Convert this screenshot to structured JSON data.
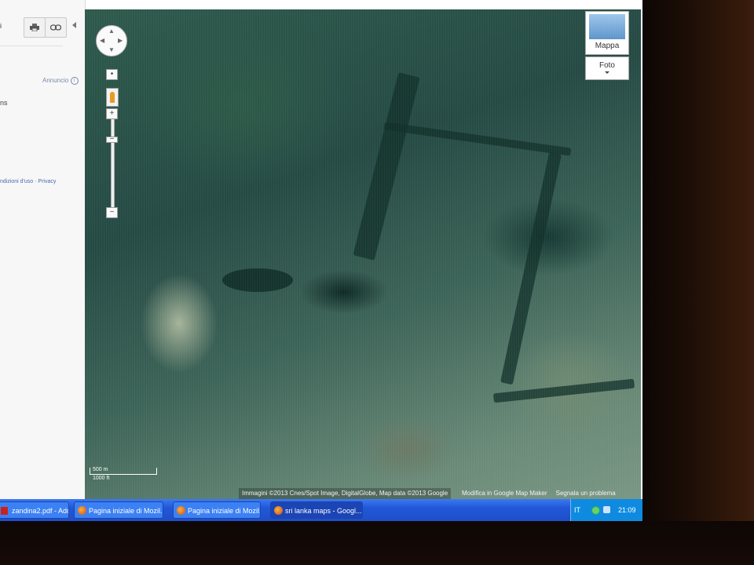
{
  "left_panel": {
    "cut_label_top": "i",
    "print_icon": "printer-icon",
    "link_icon": "link-icon",
    "collapse_icon": "chevron-left-icon",
    "ad_label": "Annuncio",
    "ad_info_icon": "info-icon",
    "cut_text": "ns",
    "footer_text": "ndizioni d'uso · Privacy"
  },
  "map": {
    "map_type_label": "Mappa",
    "photo_label": "Foto",
    "attribution": "Immagini ©2013 Cnes/Spot Image, DigitalGlobe, Map data ©2013 Google",
    "edit_link": "Modifica in Google Map Maker",
    "report_link": "Segnala un problema",
    "scale_top": "500 m",
    "scale_bottom": "1000 ft",
    "street_view_icon": "pegman-icon",
    "pan_icon": "pan-control-icon"
  },
  "taskbar": {
    "items": [
      {
        "label": "zandina2.pdf - Ado...",
        "icon": "pdf-icon"
      },
      {
        "label": "Pagina iniziale di Mozil...",
        "icon": "firefox-icon"
      },
      {
        "label": "Pagina iniziale di Mozil...",
        "icon": "firefox-icon"
      },
      {
        "label": "sri lanka maps - Googl...",
        "icon": "firefox-icon"
      }
    ],
    "lang": "IT",
    "clock": "21:09"
  }
}
